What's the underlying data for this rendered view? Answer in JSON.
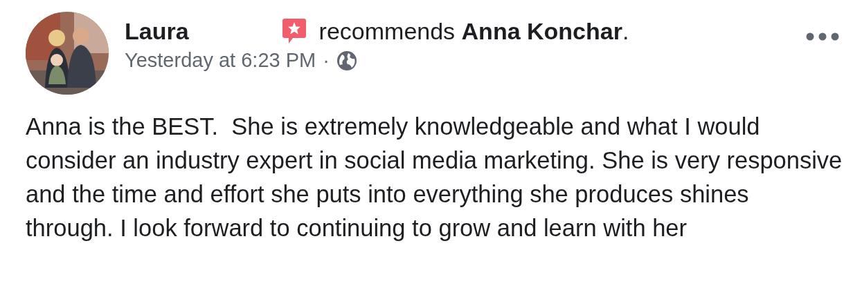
{
  "post": {
    "author": "Laura",
    "action": "recommends **Anna Konchar**.",
    "timestamp": "Yesterday at 6:23 PM",
    "separator": "·",
    "body": "Anna is the BEST.  She is extremely knowledgeable and what I would consider an industry expert in social media marketing. She is very responsive and the time and effort she puts into everything she produces shines through. I look forward to continuing to grow and learn with her"
  }
}
